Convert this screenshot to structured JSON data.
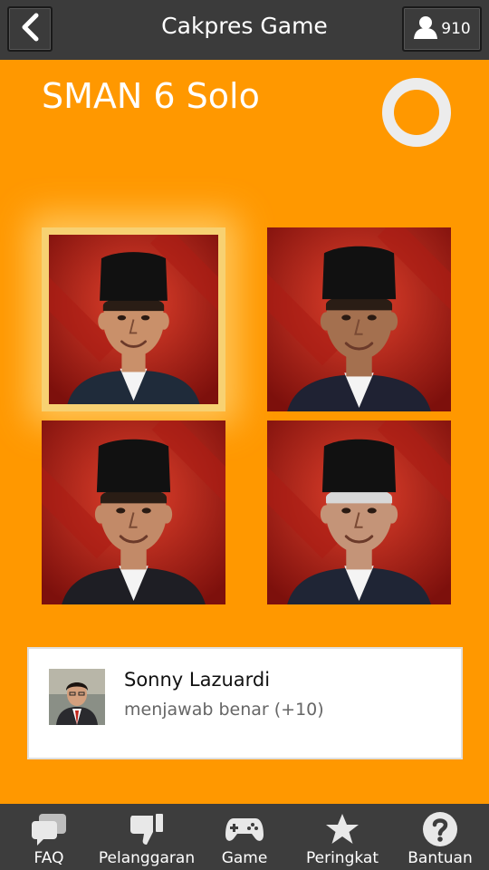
{
  "header": {
    "title": "Cakpres Game",
    "back_icon": "chevron-left-icon",
    "user_icon": "user-icon",
    "user_count": "910"
  },
  "game": {
    "school_name": "SMAN 6 Solo",
    "timer_icon": "timer-ring-icon",
    "selected_card": 1,
    "candidates": [
      {
        "id": 1,
        "skin": "#c9906a",
        "hair": "#2a1d15",
        "suit": "#1f2b3a",
        "selected": true
      },
      {
        "id": 2,
        "skin": "#a4704f",
        "hair": "#2a1d15",
        "suit": "#1f2233",
        "selected": false
      },
      {
        "id": 3,
        "skin": "#c28a68",
        "hair": "#2a1d15",
        "suit": "#1e1e24",
        "selected": false
      },
      {
        "id": 4,
        "skin": "#c49478",
        "hair": "#d8d8d8",
        "suit": "#1f2535",
        "selected": false
      }
    ]
  },
  "notification": {
    "name": "Sonny Lazuardi",
    "message": "menjawab benar (+10)"
  },
  "bottom_nav": [
    {
      "label": "FAQ",
      "icon": "chat-bubbles-icon"
    },
    {
      "label": "Pelanggaran",
      "icon": "thumbs-down-icon"
    },
    {
      "label": "Game",
      "icon": "gamepad-icon"
    },
    {
      "label": "Peringkat",
      "icon": "star-icon"
    },
    {
      "label": "Bantuan",
      "icon": "question-icon"
    }
  ],
  "colors": {
    "background": "#ff9800",
    "header": "#3b3b3b",
    "nav": "#3d3d3d",
    "selection_glow": "#f7d172",
    "card_red": "#c0261c"
  }
}
